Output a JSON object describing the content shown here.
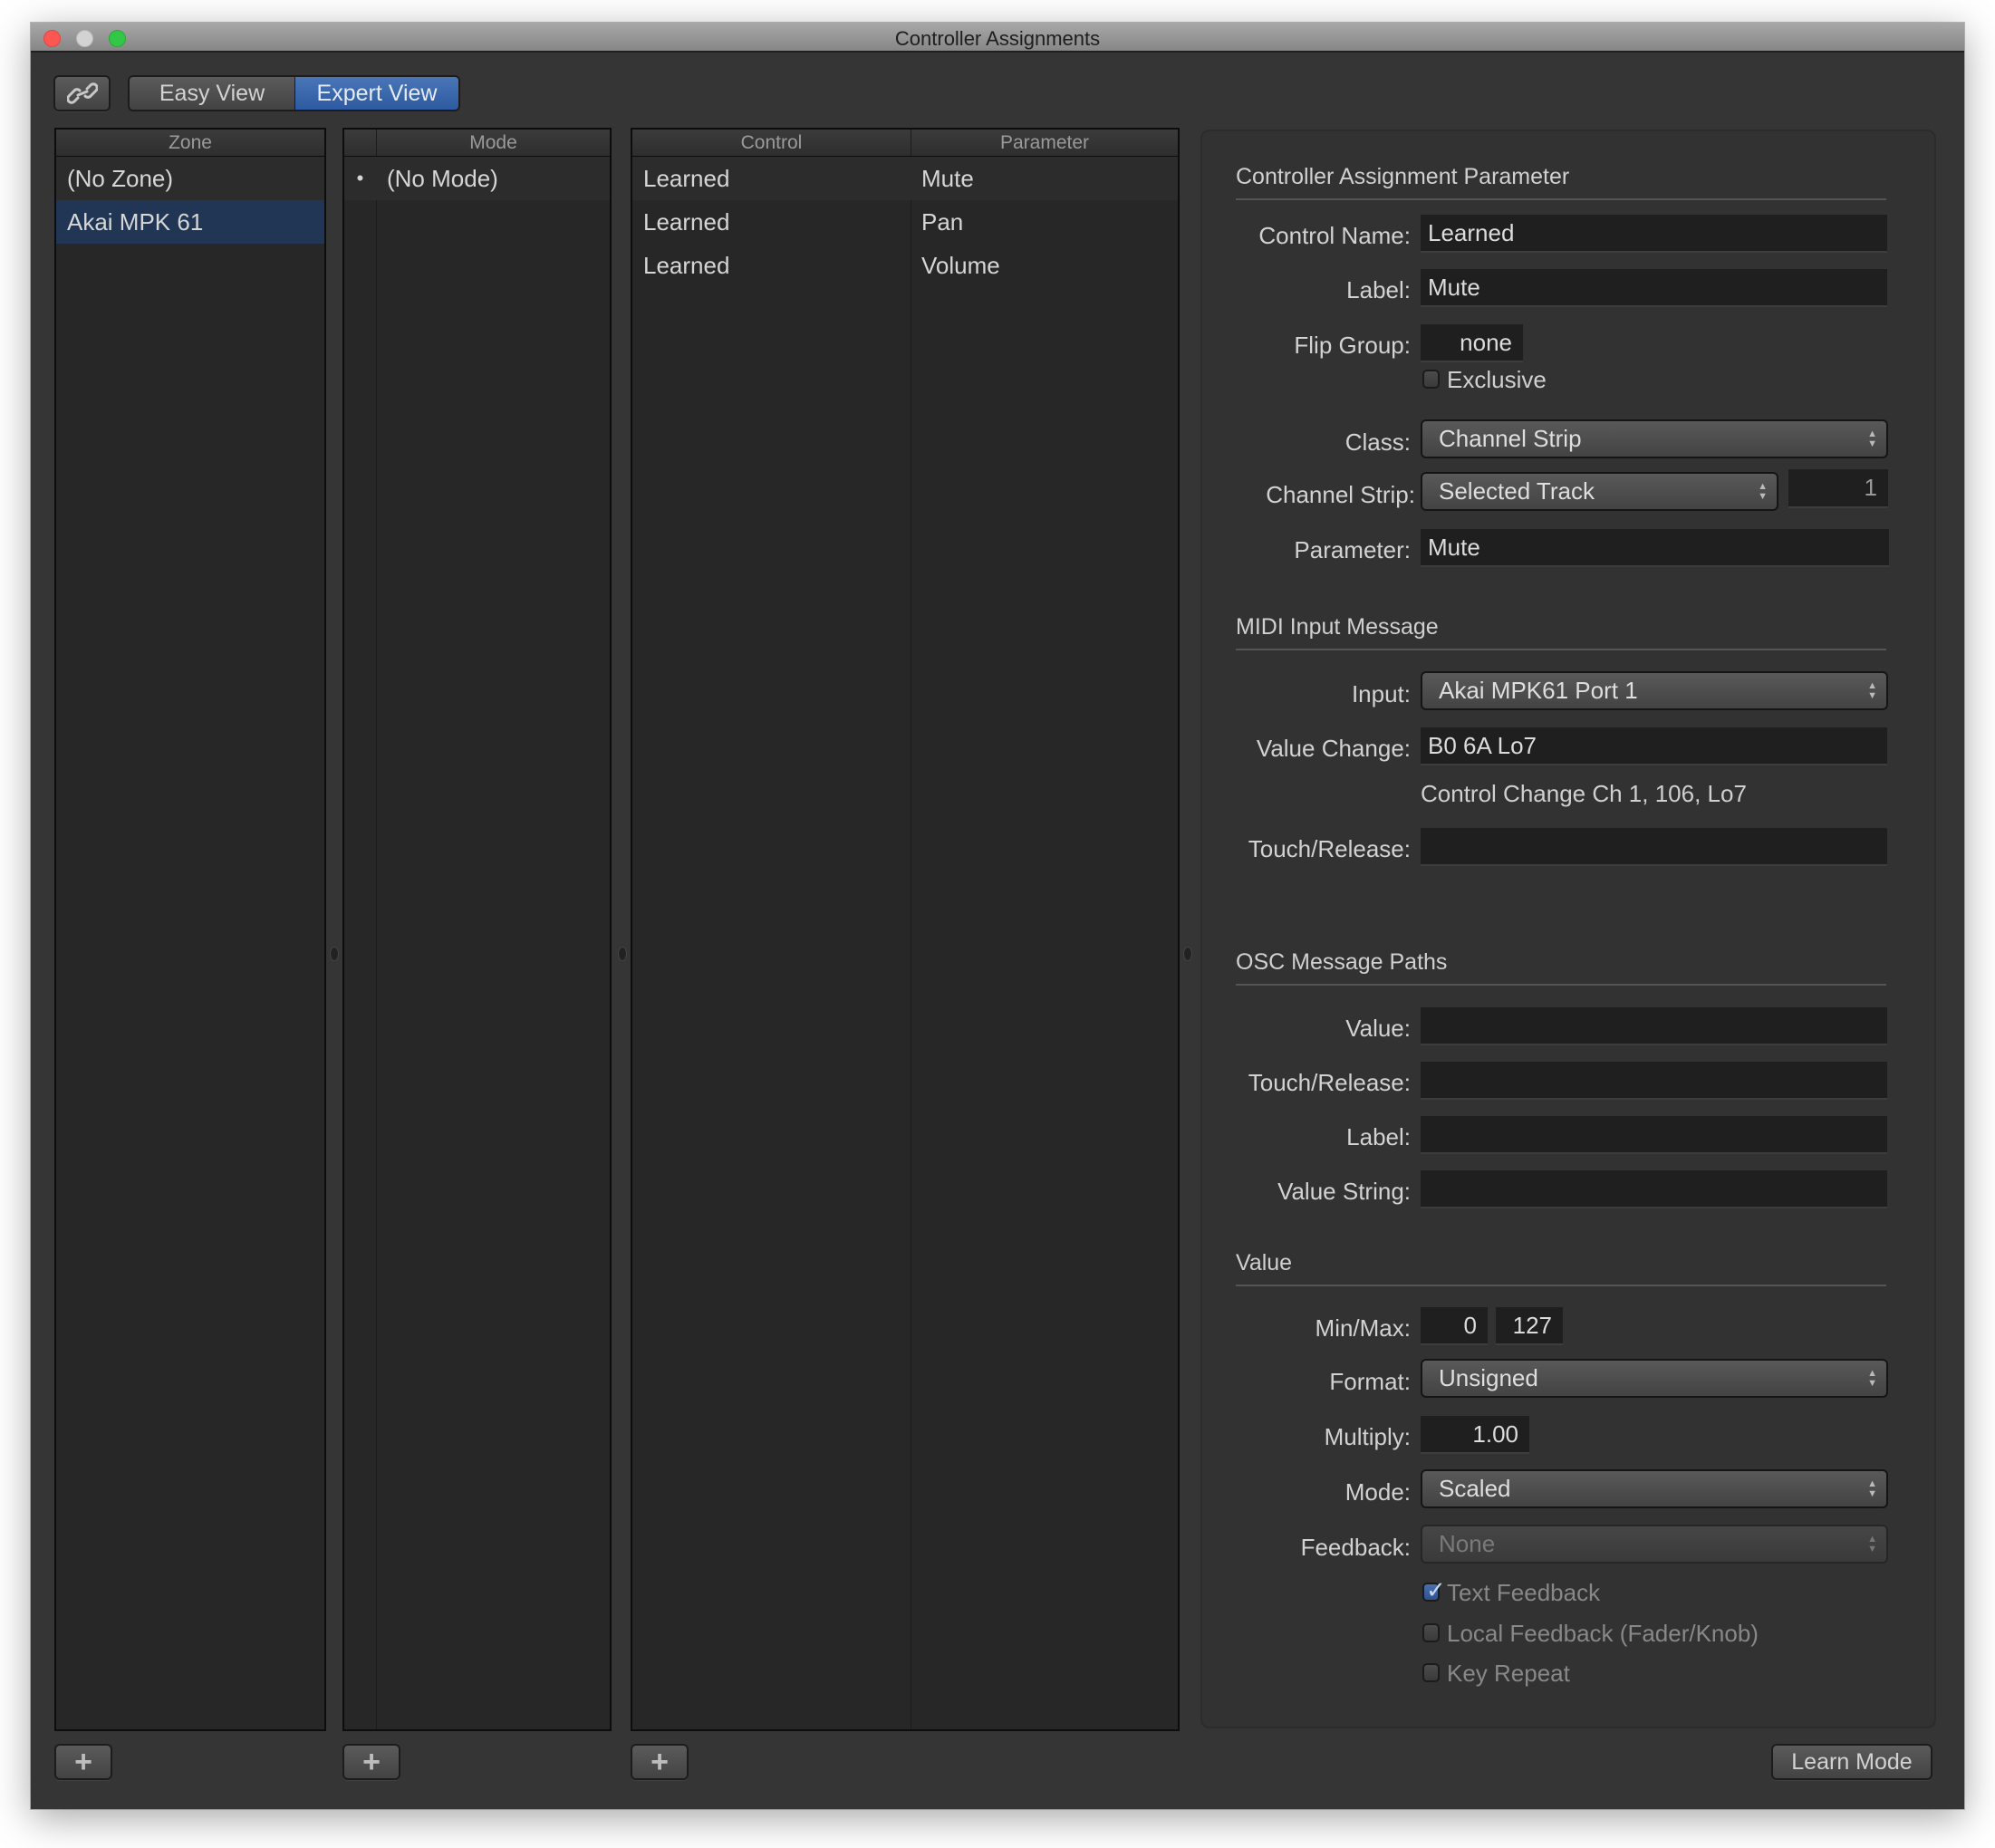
{
  "window": {
    "title": "Controller Assignments"
  },
  "toolbar": {
    "link_icon": "link-icon",
    "views": [
      {
        "label": "Easy View",
        "selected": false
      },
      {
        "label": "Expert View",
        "selected": true
      }
    ]
  },
  "zone_list": {
    "header": "Zone",
    "items": [
      {
        "label": "(No Zone)",
        "selected": false
      },
      {
        "label": "Akai MPK 61",
        "selected": true
      }
    ]
  },
  "mode_list": {
    "header": "Mode",
    "items": [
      {
        "bullet": "•",
        "label": "(No Mode)"
      }
    ]
  },
  "control_list": {
    "headers": {
      "control": "Control",
      "parameter": "Parameter"
    },
    "rows": [
      {
        "control": "Learned",
        "parameter": "Mute"
      },
      {
        "control": "Learned",
        "parameter": "Pan"
      },
      {
        "control": "Learned",
        "parameter": "Volume"
      }
    ]
  },
  "panel": {
    "assignment": {
      "title": "Controller Assignment Parameter",
      "control_name": {
        "label": "Control Name:",
        "value": "Learned"
      },
      "label": {
        "label": "Label:",
        "value": "Mute"
      },
      "flip_group": {
        "label": "Flip Group:",
        "value": "none"
      },
      "exclusive": {
        "label": "Exclusive",
        "checked": false
      },
      "class": {
        "label": "Class:",
        "value": "Channel Strip"
      },
      "channel_strip": {
        "label": "Channel Strip:",
        "value": "Selected Track",
        "number": "1"
      },
      "parameter": {
        "label": "Parameter:",
        "value": "Mute"
      }
    },
    "midi": {
      "title": "MIDI Input Message",
      "input": {
        "label": "Input:",
        "value": "Akai MPK61 Port 1"
      },
      "value_change": {
        "label": "Value Change:",
        "value": "B0 6A Lo7"
      },
      "description": "Control Change Ch 1, 106, Lo7",
      "touch_release": {
        "label": "Touch/Release:",
        "value": ""
      }
    },
    "osc": {
      "title": "OSC Message Paths",
      "value": {
        "label": "Value:",
        "value": ""
      },
      "touch_release": {
        "label": "Touch/Release:",
        "value": ""
      },
      "label": {
        "label": "Label:",
        "value": ""
      },
      "value_string": {
        "label": "Value String:",
        "value": ""
      }
    },
    "value": {
      "title": "Value",
      "min_max": {
        "label": "Min/Max:",
        "min": "0",
        "max": "127"
      },
      "format": {
        "label": "Format:",
        "value": "Unsigned"
      },
      "multiply": {
        "label": "Multiply:",
        "value": "1.00"
      },
      "mode": {
        "label": "Mode:",
        "value": "Scaled"
      },
      "feedback": {
        "label": "Feedback:",
        "value": "None",
        "enabled": false
      },
      "text_feedback": {
        "label": "Text Feedback",
        "checked": true
      },
      "local_feedback": {
        "label": "Local Feedback (Fader/Knob)",
        "checked": false
      },
      "key_repeat": {
        "label": "Key Repeat",
        "checked": false
      }
    }
  },
  "buttons": {
    "add_symbol": "+",
    "learn_mode": "Learn Mode"
  },
  "colors": {
    "accent": "#2d5aa0",
    "selection": "#213554",
    "window_bg": "#353535"
  }
}
